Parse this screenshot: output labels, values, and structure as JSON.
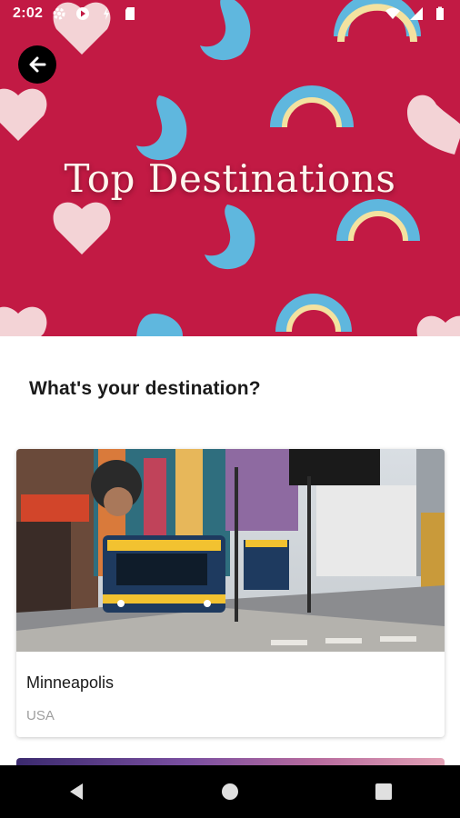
{
  "status_bar": {
    "time": "2:02",
    "icons": [
      "settings-icon",
      "play-protect-icon",
      "data-saver-icon",
      "sd-card-icon",
      "wifi-icon",
      "signal-icon",
      "battery-icon"
    ]
  },
  "hero": {
    "title": "Top Destinations",
    "background_color": "#c21a44",
    "back_icon": "arrow-left-icon"
  },
  "main": {
    "question": "What's your destination?"
  },
  "destinations": [
    {
      "city": "Minneapolis",
      "country": "USA"
    }
  ],
  "nav_bar": {
    "buttons": [
      "back-triangle-icon",
      "home-circle-icon",
      "recents-square-icon"
    ]
  }
}
